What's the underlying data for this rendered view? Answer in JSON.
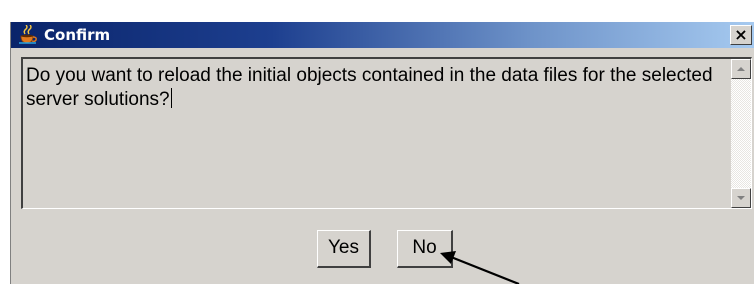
{
  "dialog": {
    "title": "Confirm",
    "app_icon": "java-cup-icon",
    "close_label": "×",
    "message": "Do you want to reload the initial objects contained in the data files for the selected server solutions?",
    "buttons": {
      "yes_label": "Yes",
      "no_label": "No"
    }
  },
  "icons": [
    "java-cup-icon",
    "close-icon",
    "scroll-up-arrow-icon",
    "scroll-down-arrow-icon",
    "pointer-arrow-icon"
  ],
  "colors": {
    "title_gradient_start": "#0a246a",
    "title_gradient_end": "#a6caf0",
    "dialog_face": "#d6d3ce"
  }
}
